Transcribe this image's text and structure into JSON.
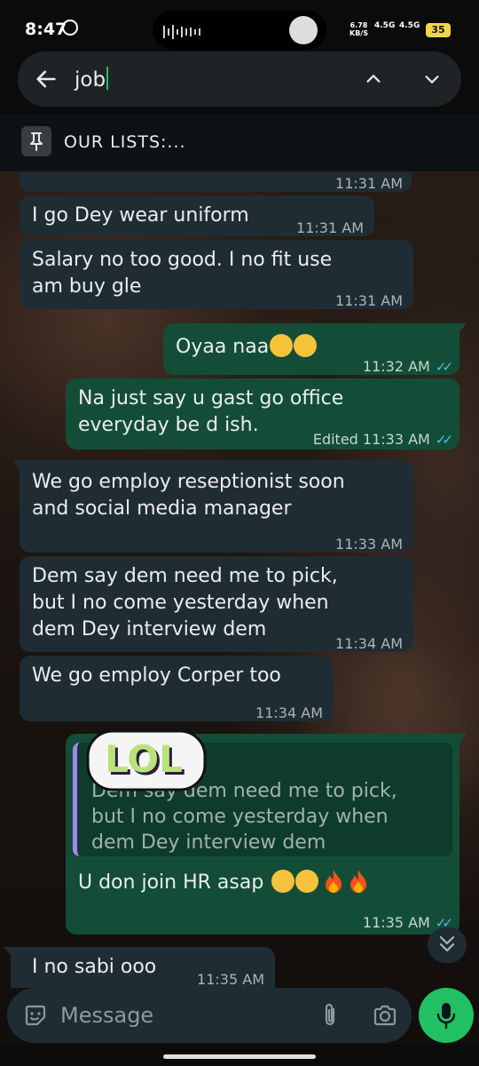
{
  "status_bar": {
    "time": "8:47",
    "net_speed_value": "6.78",
    "net_speed_unit": "KB/S",
    "network_a": "4.5G",
    "network_b": "4.5G",
    "battery": "35"
  },
  "search": {
    "query": "job"
  },
  "pinned": {
    "text": "OUR LISTS:..."
  },
  "messages": [
    {
      "direction": "in",
      "text": "",
      "time": "11:31 AM"
    },
    {
      "direction": "in",
      "text": "I go Dey wear uniform",
      "time": "11:31 AM"
    },
    {
      "direction": "in",
      "line1": "Salary no too good. I no fit use",
      "line2": "am buy gle",
      "time": "11:31 AM"
    },
    {
      "direction": "out",
      "text": "Oyaa naa",
      "time": "11:32 AM"
    },
    {
      "direction": "out",
      "line1": "Na just say u gast go office",
      "line2": "everyday be d ish.",
      "time": "Edited 11:33 AM"
    },
    {
      "direction": "in",
      "line1": "We go employ reseptionist soon",
      "line2": "and social media manager",
      "time": "11:33 AM"
    },
    {
      "direction": "in",
      "line1": "Dem say dem need me to pick,",
      "line2": "but I no come yesterday when",
      "line3": "dem Dey interview dem",
      "time": "11:34 AM"
    },
    {
      "direction": "in",
      "text": "We go employ Corper too",
      "time": "11:34 AM"
    },
    {
      "direction": "out",
      "quote_line1": "Dem say dem need me to pick,",
      "quote_line2": "but I no come yesterday when",
      "quote_line3": "dem Dey interview dem",
      "text": "U don join HR asap",
      "time": "11:35 AM"
    },
    {
      "direction": "in",
      "text": "I no sabi ooo",
      "time": "11:35 AM"
    }
  ],
  "sticker": {
    "text": "LOL"
  },
  "composer": {
    "placeholder": "Message"
  },
  "icons": {
    "back": "arrow-left-icon",
    "up": "chevron-up-icon",
    "down": "chevron-down-icon",
    "pin": "pin-icon",
    "emoji": "rolling-laughing-emoji",
    "fire": "fire-emoji",
    "sticker": "sticker-icon",
    "attach": "paperclip-icon",
    "camera": "camera-icon",
    "mic": "mic-icon",
    "scroll": "double-chevron-down-icon"
  },
  "colors": {
    "incoming_bubble": "#202c33",
    "outgoing_bubble": "#144d37",
    "accent_green": "#21c063",
    "read_ticks": "#53bdeb",
    "quote_bar": "#a785f0"
  }
}
